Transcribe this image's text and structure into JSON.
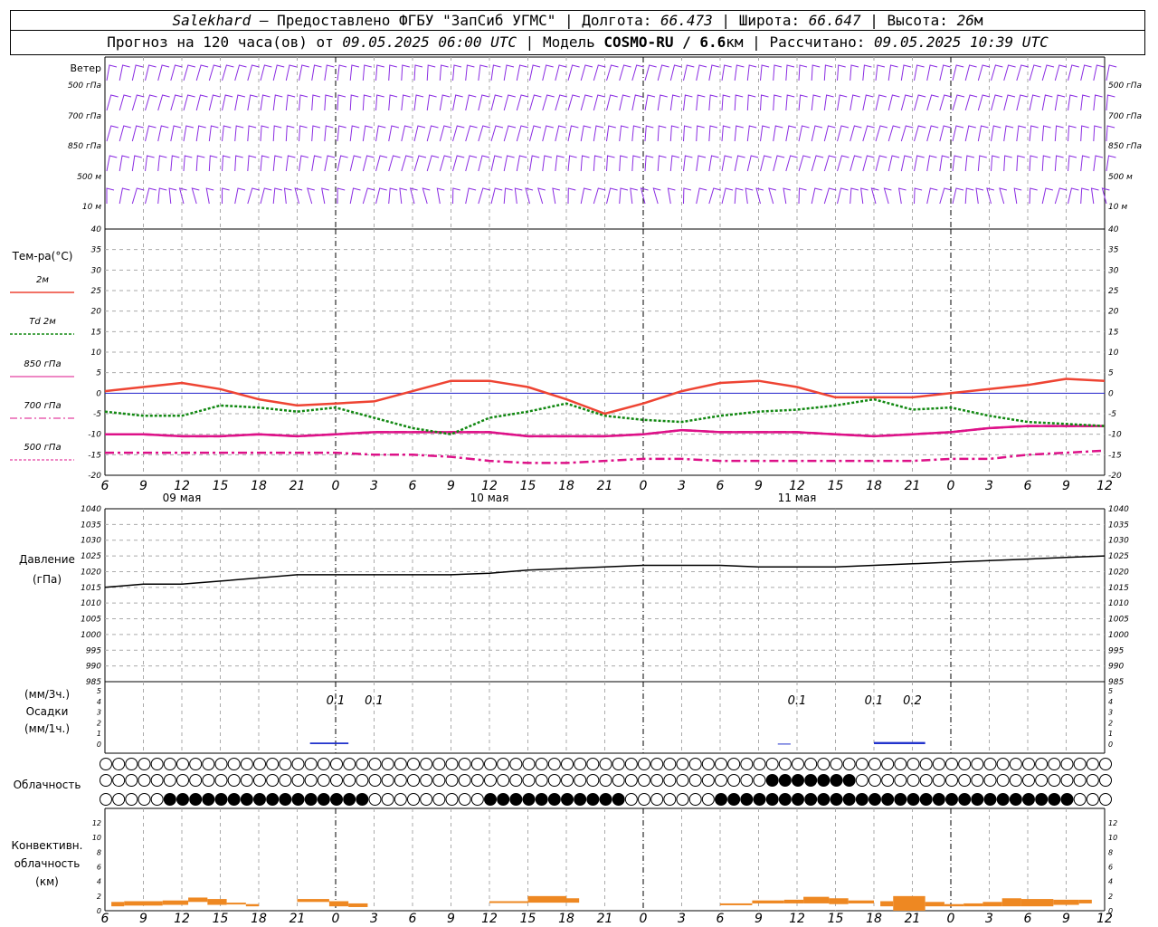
{
  "header": {
    "station": "Salekhard",
    "provider": "– Предоставлено ФГБУ \"ЗапСиб УГМС\"",
    "lon_label": "Долгота:",
    "lon": "66.473",
    "lat_label": "Широта:",
    "lat": "66.647",
    "alt_label": "Высота:",
    "alt": "26",
    "alt_unit": "м",
    "sep": "|",
    "forecast_prefix": "Прогноз на 120 часа(ов) от",
    "forecast_time": "09.05.2025 06:00 UTC",
    "model_label": "Модель",
    "model": "COSMO-RU / 6.6",
    "model_unit": "км",
    "computed_label": "Рассчитано:",
    "computed_time": "09.05.2025 10:39 UTC"
  },
  "colors": {
    "wind": "#8a2be2",
    "t2m": "#ee4433",
    "td2m": "#118811",
    "t850": "#dd1188",
    "t700": "#dd1188",
    "t500": "#dd1188",
    "pressure": "#000000",
    "precip": "#2233cc",
    "convective": "#ee8822",
    "zero_line": "#2222cc",
    "grid": "#aaaaaa"
  },
  "chart_data": [
    {
      "type": "wind-barbs",
      "row_label": "Ветер",
      "levels": [
        "500 гПа",
        "700 гПа",
        "850 гПа",
        "500 м",
        "10 м"
      ]
    },
    {
      "type": "line",
      "ylabel": "Тем-ра(°C)",
      "ylim": [
        -20,
        40
      ],
      "yticks": [
        -20,
        -15,
        -10,
        -5,
        0,
        5,
        10,
        15,
        20,
        25,
        30,
        35,
        40
      ],
      "x_ticks": [
        "6",
        "9",
        "12",
        "15",
        "18",
        "21",
        "0",
        "3",
        "6",
        "9",
        "12",
        "15",
        "18",
        "21",
        "0",
        "3",
        "6",
        "9",
        "12",
        "15",
        "18",
        "21",
        "0",
        "3",
        "6",
        "9",
        "12"
      ],
      "date_labels": [
        "09 мая",
        "10 мая",
        "11 мая"
      ],
      "series": [
        {
          "name": "2м",
          "values": [
            0.5,
            1.5,
            2.5,
            1.0,
            -1.5,
            -3.0,
            -2.5,
            -2.0,
            0.5,
            3.0,
            3.0,
            1.5,
            -1.5,
            -5.0,
            -2.5,
            0.5,
            2.5,
            3.0,
            1.5,
            -1.0,
            -1.0,
            -1.0,
            0.0,
            1.0,
            2.0,
            3.5,
            3.0
          ]
        },
        {
          "name": "Td 2м",
          "values": [
            -4.5,
            -5.5,
            -5.5,
            -3.0,
            -3.5,
            -4.5,
            -3.5,
            -6.0,
            -8.5,
            -10.0,
            -6.0,
            -4.5,
            -2.5,
            -5.5,
            -6.5,
            -7.0,
            -5.5,
            -4.5,
            -4.0,
            -3.0,
            -1.5,
            -4.0,
            -3.5,
            -5.5,
            -7.0,
            -7.5,
            -8.0
          ]
        },
        {
          "name": "850 гПа",
          "values": [
            -10.0,
            -10.0,
            -10.5,
            -10.5,
            -10.0,
            -10.5,
            -10.0,
            -9.5,
            -9.5,
            -9.5,
            -9.5,
            -10.5,
            -10.5,
            -10.5,
            -10.0,
            -9.0,
            -9.5,
            -9.5,
            -9.5,
            -10.0,
            -10.5,
            -10.0,
            -9.5,
            -8.5,
            -8.0,
            -8.0,
            -8.0
          ]
        },
        {
          "name": "700 гПа",
          "values": [
            -10.0,
            -10.0,
            -10.5,
            -10.5,
            -10.0,
            -10.5,
            -10.0,
            -9.5,
            -9.5,
            -9.5,
            -9.5,
            -10.5,
            -10.5,
            -10.5,
            -10.0,
            -9.0,
            -9.5,
            -9.5,
            -9.5,
            -10.0,
            -10.5,
            -10.0,
            -9.5,
            -8.5,
            -8.0,
            -8.0,
            -8.0
          ]
        },
        {
          "name": "500 гПа",
          "values": [
            -14.5,
            -14.5,
            -14.5,
            -14.5,
            -14.5,
            -14.5,
            -14.5,
            -15.0,
            -15.0,
            -15.5,
            -16.5,
            -17.0,
            -17.0,
            -16.5,
            -16.0,
            -16.0,
            -16.5,
            -16.5,
            -16.5,
            -16.5,
            -16.5,
            -16.5,
            -16.0,
            -16.0,
            -15.0,
            -14.5,
            -14.0
          ]
        }
      ]
    },
    {
      "type": "line",
      "ylabel": "Давление",
      "yunit": "(гПа)",
      "ylim": [
        985,
        1040
      ],
      "yticks": [
        985,
        990,
        995,
        1000,
        1005,
        1010,
        1015,
        1020,
        1025,
        1030,
        1035,
        1040
      ],
      "series": [
        {
          "name": "Давление",
          "values": [
            1015,
            1016,
            1016,
            1017,
            1018,
            1019,
            1019,
            1019,
            1019,
            1019,
            1019.5,
            1020.5,
            1021,
            1021.5,
            1022,
            1022,
            1022,
            1021.5,
            1021.5,
            1021.5,
            1022,
            1022.5,
            1023,
            1023.5,
            1024,
            1024.5,
            1025
          ]
        }
      ]
    },
    {
      "type": "bar",
      "ylabel": "Осадки",
      "yunit_3h": "(мм/3ч.)",
      "yunit_1h": "(мм/1ч.)",
      "ylim": [
        0,
        5
      ],
      "yticks": [
        0,
        1,
        2,
        3,
        4,
        5
      ],
      "labels": [
        {
          "x_hours": 18,
          "text": "0.1"
        },
        {
          "x_hours": 21,
          "text": "0.1"
        },
        {
          "x_hours": 54,
          "text": "0.1"
        },
        {
          "x_hours": 60,
          "text": "0.1"
        },
        {
          "x_hours": 63,
          "text": "0.2"
        }
      ],
      "bars": [
        {
          "from": 16,
          "to": 19,
          "value": 0.15
        },
        {
          "from": 52.5,
          "to": 53.5,
          "value": 0.05
        },
        {
          "from": 60,
          "to": 64,
          "value": 0.2
        }
      ]
    },
    {
      "type": "cloud-cover",
      "label": "Облачность",
      "rows": 3
    },
    {
      "type": "bar",
      "ylabel": "Конвективн.",
      "ylabel2": "облачность",
      "yunit": "(км)",
      "ylim": [
        0,
        13
      ],
      "yticks": [
        0,
        2,
        4,
        6,
        8,
        10,
        12
      ],
      "segments": [
        {
          "from": 0.5,
          "to": 1.5,
          "top": 1.2
        },
        {
          "from": 1.5,
          "to": 4.5,
          "top": 1.3
        },
        {
          "from": 4.5,
          "to": 6.5,
          "top": 1.4
        },
        {
          "from": 6.5,
          "to": 8,
          "top": 1.8
        },
        {
          "from": 8,
          "to": 9.5,
          "top": 1.6,
          "bottom": 0.8
        },
        {
          "from": 9.5,
          "to": 11,
          "top": 1.1,
          "bottom": 0.9
        },
        {
          "from": 11,
          "to": 12,
          "top": 0.9,
          "bottom": 0.6
        },
        {
          "from": 15,
          "to": 17.5,
          "top": 1.6,
          "bottom": 1.2
        },
        {
          "from": 17.5,
          "to": 19,
          "top": 1.3,
          "bottom": 0.6
        },
        {
          "from": 19,
          "to": 20.5,
          "top": 1.0,
          "bottom": 0.5
        },
        {
          "from": 30,
          "to": 33,
          "top": 1.3,
          "bottom": 1.1
        },
        {
          "from": 33,
          "to": 36,
          "top": 2.0,
          "bottom": 1.1
        },
        {
          "from": 36,
          "to": 37,
          "top": 1.7,
          "bottom": 1.1
        },
        {
          "from": 48,
          "to": 50.5,
          "top": 1.0,
          "bottom": 0.9
        },
        {
          "from": 50.5,
          "to": 53,
          "top": 1.4,
          "bottom": 1.0
        },
        {
          "from": 53,
          "to": 54.5,
          "top": 1.5,
          "bottom": 1.0
        },
        {
          "from": 54.5,
          "to": 56.5,
          "top": 1.9,
          "bottom": 1.0
        },
        {
          "from": 56.5,
          "to": 58,
          "top": 1.7,
          "bottom": 0.9
        },
        {
          "from": 58,
          "to": 60,
          "top": 1.4,
          "bottom": 1.0
        },
        {
          "from": 60.5,
          "to": 61.5,
          "top": 1.3,
          "bottom": 0.6
        },
        {
          "from": 61.5,
          "to": 64,
          "top": 2.0,
          "bottom": 0.0
        },
        {
          "from": 64,
          "to": 65.5,
          "top": 1.2,
          "bottom": 0.6
        },
        {
          "from": 65.5,
          "to": 67,
          "top": 0.9,
          "bottom": 0.6
        },
        {
          "from": 67,
          "to": 68.5,
          "top": 1.0,
          "bottom": 0.6
        },
        {
          "from": 68.5,
          "to": 70,
          "top": 1.2,
          "bottom": 0.6
        },
        {
          "from": 70,
          "to": 71.5,
          "top": 1.7,
          "bottom": 0.6
        },
        {
          "from": 71.5,
          "to": 74,
          "top": 1.6,
          "bottom": 0.6
        },
        {
          "from": 74,
          "to": 76,
          "top": 1.5,
          "bottom": 0.8
        },
        {
          "from": 76,
          "to": 77,
          "top": 1.5,
          "bottom": 1.0
        }
      ]
    }
  ]
}
